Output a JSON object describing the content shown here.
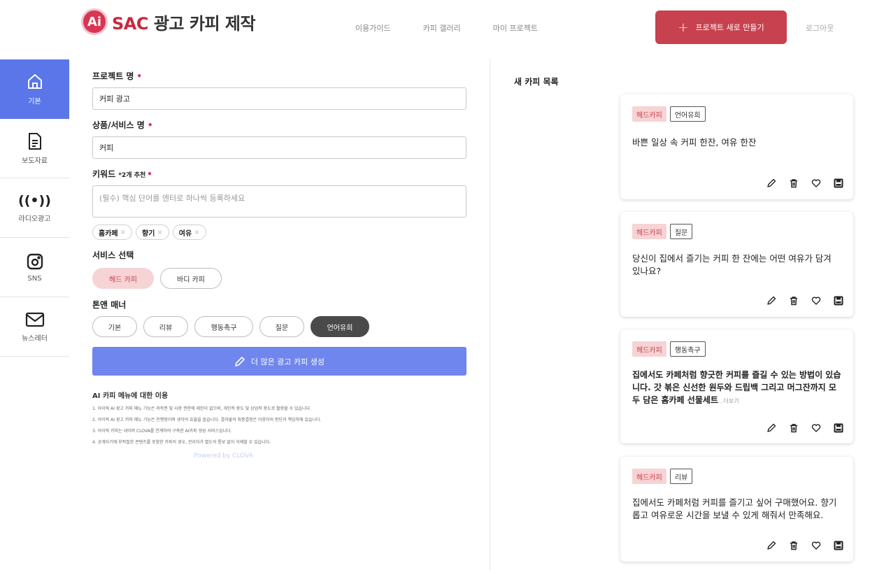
{
  "header": {
    "logo_badge": "Ai",
    "logo_brand": "SAC",
    "logo_title": "광고 카피 제작",
    "nav": [
      "이용가이드",
      "카피 갤러리",
      "마이 프로젝트"
    ],
    "new_project_label": "프로젝트 새로 만들기",
    "logout_label": "로그아웃"
  },
  "sidebar": {
    "items": [
      {
        "label": "기본",
        "icon": "home-icon"
      },
      {
        "label": "보도자료",
        "icon": "document-icon"
      },
      {
        "label": "라디오광고",
        "icon": "radio-icon"
      },
      {
        "label": "SNS",
        "icon": "sns-icon"
      },
      {
        "label": "뉴스레터",
        "icon": "mail-icon"
      }
    ]
  },
  "form": {
    "project_label": "프로젝트 명",
    "project_value": "커피 광고",
    "product_label": "상품/서비스 명",
    "product_value": "커피",
    "keyword_label": "키워드",
    "keyword_hint": "*2개 추천",
    "keyword_placeholder": "(필수) 핵심 단어를 엔터로 하나씩 등록하세요",
    "keywords": [
      "홈카페",
      "향기",
      "여유"
    ],
    "service_label": "서비스 선택",
    "services": [
      "헤드 카피",
      "바디 카피"
    ],
    "tone_label": "톤앤 매너",
    "tones": [
      "기본",
      "리뷰",
      "행동촉구",
      "질문",
      "언어유희"
    ],
    "generate_label": "더 많은 광고 카피 생성",
    "notice_title": "AI 카피 메뉴에 대한 이용",
    "notices": [
      "1. 아이픽 AI 광고 카피 메뉴 기능은 저작권 및 사용 권한에 제한이 없으며, 개인적 용도 및 상업적 용도로 활용할 수 있습니다.",
      "2. 아이픽 AI 광고 카피 메뉴 기능은 진행형이며 생각의 효율을 돕습니다. 결과물의 최종결정은 이용자의 판단과 책임하에 있습니다.",
      "3. 아이픽 카피는 네이버 CLOVA를 연계하여 구축한 AI카피 생성 서비스입니다.",
      "4. 공개되기에 부적절한 콘텐츠를 포함한 카피의 경우, 관리자가 별도의 통보 없이 삭제할 수 있습니다."
    ],
    "powered": "Powered by CLOVA"
  },
  "copy_list": {
    "title": "새 카피 목록",
    "cards": [
      {
        "tag": "헤드카피",
        "type": "언어유희",
        "text": "바쁜 일상 속 커피 한잔, 여유 한잔",
        "more": ""
      },
      {
        "tag": "헤드카피",
        "type": "질문",
        "text": "당신이 집에서 즐기는 커피 한 잔에는 어떤 여유가 담겨 있나요?",
        "more": ""
      },
      {
        "tag": "헤드카피",
        "type": "행동촉구",
        "text": "집에서도 카페처럼 향긋한 커피를 즐길 수 있는 방법이 있습니다. 갓 볶은 신선한 원두와 드립백 그리고 머그잔까지 모두 담은 홈카페 선물세트",
        "more": "...더보기"
      },
      {
        "tag": "헤드카피",
        "type": "리뷰",
        "text": "집에서도 카페처럼 커피를 즐기고 싶어 구매했어요. 향기롭고 여유로운 시간을 보낼 수 있게 해줘서 만족해요.",
        "more": ""
      }
    ]
  },
  "colors": {
    "accent_red": "#c8414f",
    "accent_blue": "#5a76e8",
    "button_blue": "#6f86ee",
    "pink_bg": "#f6d3d5"
  }
}
